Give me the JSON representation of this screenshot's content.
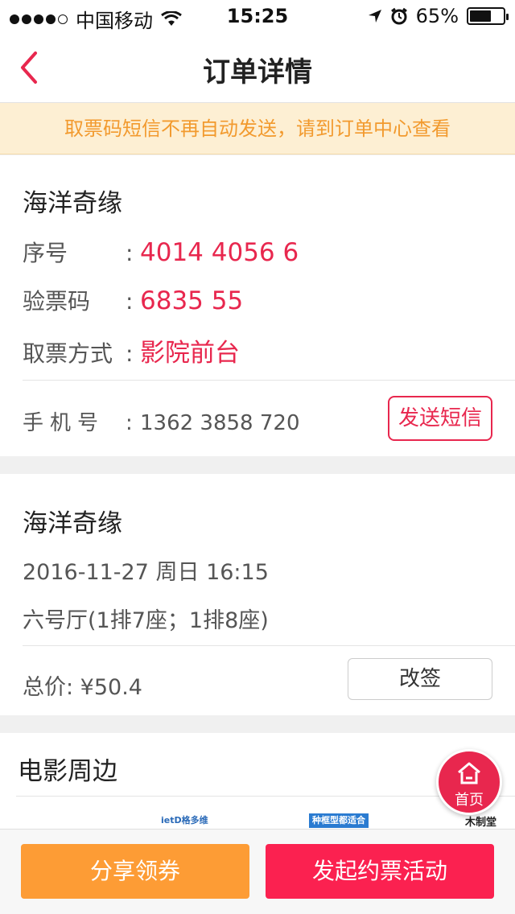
{
  "status_bar": {
    "carrier": "中国移动",
    "time": "15:25",
    "battery_text": "65%",
    "battery_level": 0.65
  },
  "nav": {
    "title": "订单详情"
  },
  "notice": "取票码短信不再自动发送，请到订单中心查看",
  "ticket": {
    "movie": "海洋奇缘",
    "serial_label": "序号",
    "serial_value": "4014 4056 6",
    "code_label": "验票码",
    "code_value": "6835 55",
    "pickup_label": "取票方式",
    "pickup_value": "影院前台",
    "phone_label": "手机号",
    "phone_value": "1362 3858 720",
    "send_sms_label": "发送短信",
    "colon": "："
  },
  "showing": {
    "movie": "海洋奇缘",
    "datetime": "2016-11-27 周日 16:15",
    "hall": "六号厅(1排7座；1排8座)",
    "total": "总价: ¥50.4",
    "change_label": "改签"
  },
  "peripherals": {
    "title": "电影周边",
    "thumb_texts": [
      "ietD格多维",
      "种框型都适合",
      "木制堂"
    ]
  },
  "home_button": {
    "label": "首页"
  },
  "actions": {
    "share": "分享领券",
    "start": "发起约票活动"
  },
  "colors": {
    "accent_red": "#e8274e",
    "orange": "#fd9c35",
    "notice_bg": "#fdefd3",
    "notice_text": "#f29a2e"
  }
}
